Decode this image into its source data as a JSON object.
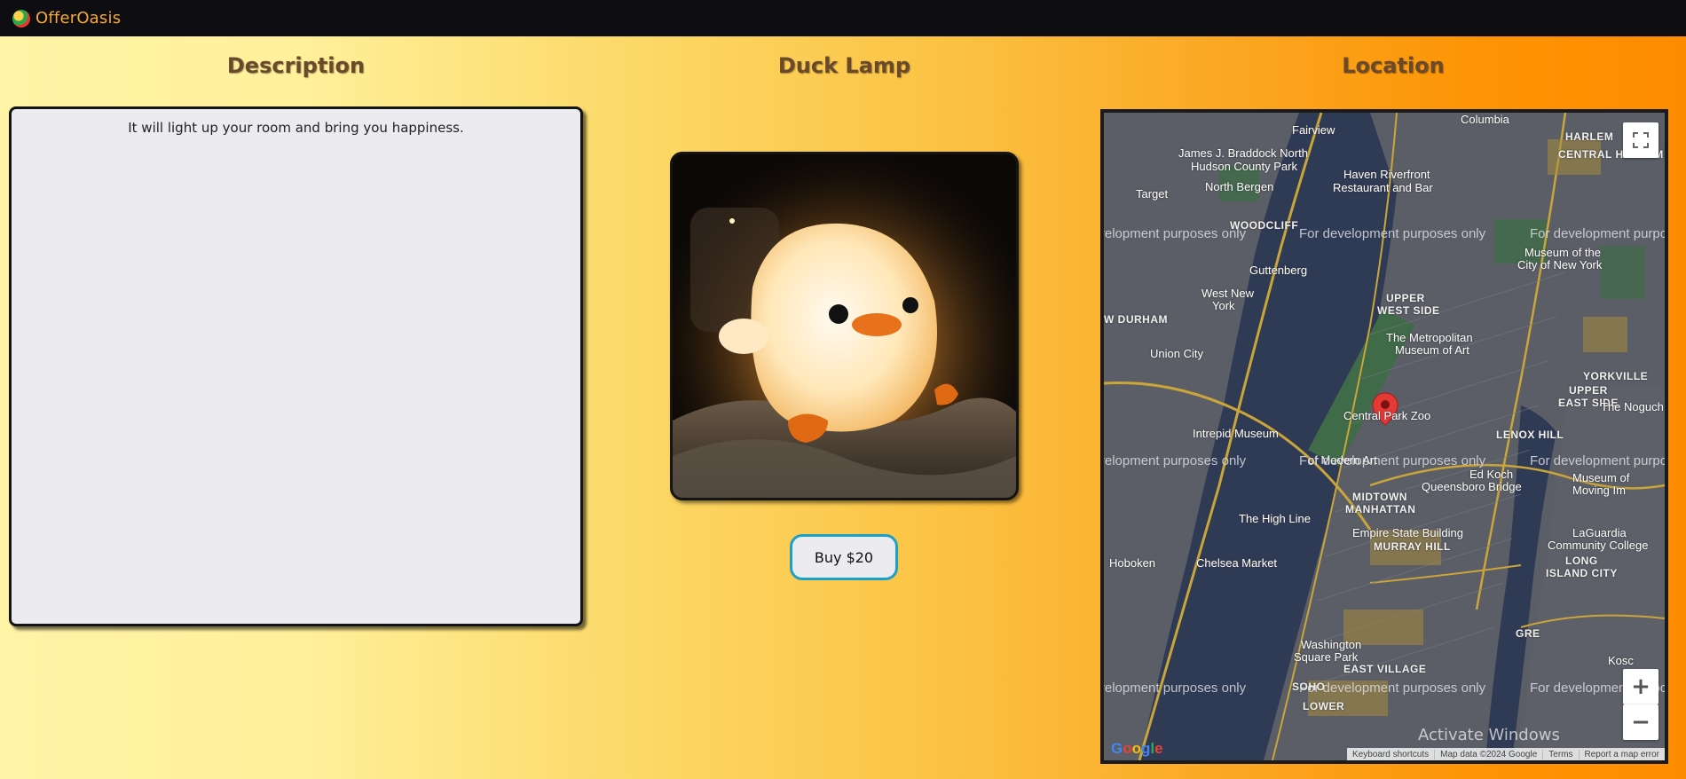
{
  "header": {
    "brand": "OfferOasis",
    "logo_icon": "globe-logo-icon"
  },
  "columns": {
    "description_title": "Description",
    "product_title": "Duck Lamp",
    "location_title": "Location"
  },
  "description": {
    "text": "It will light up your room and bring you happiness."
  },
  "product": {
    "image_alt": "Duck Lamp",
    "buy_label": "Buy $20"
  },
  "map": {
    "dev_watermark": "For development purposes only",
    "labels": {
      "fairview": "Fairview",
      "columbia": "Columbia",
      "harlem": "HARLEM",
      "central_harlem": "CENTRAL HARLEM",
      "james": "James J. Braddock North",
      "hudson": "Hudson County Park",
      "haven": "Haven Riverfront",
      "haven2": "Restaurant and Bar",
      "target": "Target",
      "north_bergen": "North Bergen",
      "woodcliff": "WOODCLIFF",
      "guttenberg": "Guttenberg",
      "museum_city": "Museum of the",
      "museum_city2": "City of New York",
      "west_ny": "West New",
      "west_ny2": "York",
      "w_durham": "W DURHAM",
      "upper_west": "UPPER",
      "upper_west2": "WEST SIDE",
      "union_city": "Union City",
      "met": "The Metropolitan",
      "met2": "Museum of Art",
      "yorkville": "YORKVILLE",
      "upper_east": "UPPER",
      "upper_east2": "EAST SIDE",
      "noguchi": "The Noguch",
      "central_park_zoo": "Central Park Zoo",
      "intrepid": "Intrepid Museum",
      "lenox": "LENOX HILL",
      "moma": "of Modern Art",
      "ed_koch": "Ed Koch",
      "queensboro": "Queensboro Bridge",
      "museum_moving": "Museum of",
      "museum_moving2": "Moving Im",
      "midtown": "MIDTOWN",
      "manhattan": "MANHATTAN",
      "high_line": "The High Line",
      "empire": "Empire State Building",
      "murray": "MURRAY HILL",
      "laguardia": "LaGuardia",
      "laguardia2": "Community College",
      "hoboken": "Hoboken",
      "chelsea": "Chelsea Market",
      "long_island": "LONG",
      "long_island2": "ISLAND CITY",
      "washington": "Washington",
      "washington2": "Square Park",
      "east_village": "EAST VILLAGE",
      "soho": "SOHO",
      "lower": "LOWER",
      "gre": "GRE",
      "kosc": "Kosc"
    },
    "attribution": {
      "shortcuts": "Keyboard shortcuts",
      "map_data": "Map data ©2024 Google",
      "terms": "Terms",
      "report": "Report a map error"
    },
    "google": "Google",
    "zoom_in": "+",
    "zoom_out": "−"
  },
  "os_watermark": "Activate Windows",
  "colors": {
    "topbar": "#0d0d12",
    "brand": "#f4a93a",
    "title": "#6b4a2c",
    "panel": "#ececf0",
    "button_border": "#1ba0c8",
    "map_water": "#2f3a55",
    "map_land": "#5b5e66",
    "park": "#3f6b48",
    "pin": "#e53935"
  }
}
